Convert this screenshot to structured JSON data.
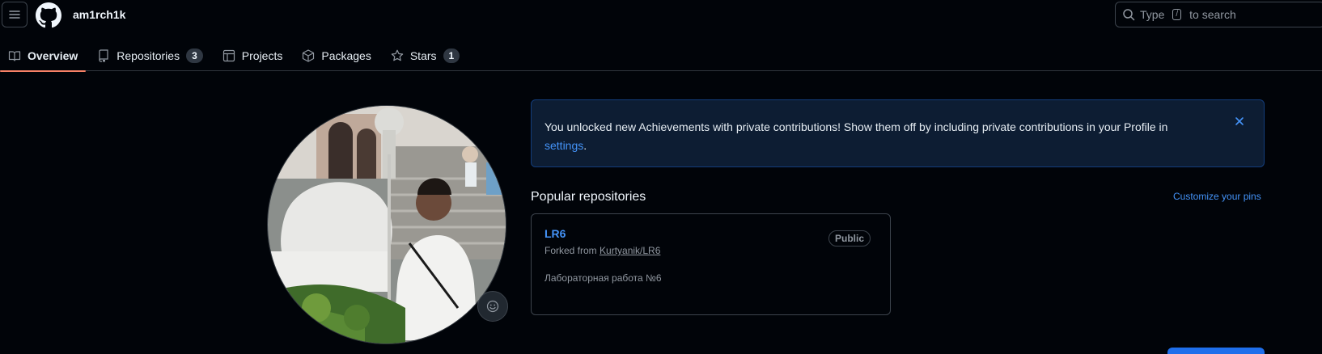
{
  "header": {
    "username": "am1rch1k",
    "search": {
      "prefix": "Type",
      "key": "/",
      "suffix": "to search"
    }
  },
  "tabs": [
    {
      "label": "Overview",
      "icon": "book-icon",
      "active": true
    },
    {
      "label": "Repositories",
      "icon": "repo-icon",
      "count": "3"
    },
    {
      "label": "Projects",
      "icon": "table-icon"
    },
    {
      "label": "Packages",
      "icon": "package-icon"
    },
    {
      "label": "Stars",
      "icon": "star-icon",
      "count": "1"
    }
  ],
  "banner": {
    "text": "You unlocked new Achievements with private contributions! Show them off by including private contributions in your Profile in",
    "link": "settings",
    "end": "."
  },
  "popular": {
    "title": "Popular repositories",
    "customize": "Customize your pins",
    "repos": [
      {
        "name": "LR6",
        "visibility": "Public",
        "forked_prefix": "Forked from",
        "forked_from": "Kurtyanik/LR6",
        "description": "Лабораторная работа №6"
      }
    ]
  },
  "colors": {
    "background": "#010409",
    "accent": "#4493f8",
    "tab_underline": "#f78166",
    "banner_bg": "#0d1d33"
  }
}
